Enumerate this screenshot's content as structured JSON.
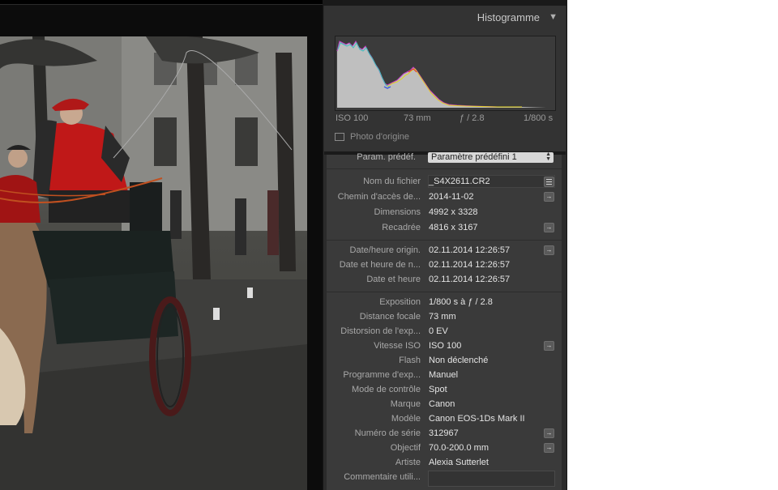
{
  "histogram": {
    "title": "Histogramme",
    "iso": "ISO 100",
    "focal": "73 mm",
    "aperture": "ƒ / 2.8",
    "shutter": "1/800 s",
    "original_photo_label": "Photo d'origine"
  },
  "preset": {
    "label": "Param. prédéf.",
    "value": "Paramètre prédéfini 1"
  },
  "file_group": [
    {
      "label": "Nom du fichier",
      "value": "_S4X2611.CR2",
      "button": "list"
    },
    {
      "label": "Chemin d'accès de...",
      "value": "2014-11-02",
      "button": "arrow"
    },
    {
      "label": "Dimensions",
      "value": "4992 x 3328",
      "button": ""
    },
    {
      "label": "Recadrée",
      "value": "4816 x 3167",
      "button": "arrow"
    }
  ],
  "date_group": [
    {
      "label": "Date/heure origin.",
      "value": "02.11.2014 12:26:57",
      "button": "arrow"
    },
    {
      "label": "Date et heure de n...",
      "value": "02.11.2014 12:26:57",
      "button": ""
    },
    {
      "label": "Date et heure",
      "value": "02.11.2014 12:26:57",
      "button": ""
    }
  ],
  "exif_group": [
    {
      "label": "Exposition",
      "value": "1/800 s à ƒ / 2.8",
      "button": ""
    },
    {
      "label": "Distance focale",
      "value": "73 mm",
      "button": ""
    },
    {
      "label": "Distorsion de l'exp...",
      "value": "0 EV",
      "button": ""
    },
    {
      "label": "Vitesse ISO",
      "value": "ISO 100",
      "button": "arrow"
    },
    {
      "label": "Flash",
      "value": "Non déclenché",
      "button": ""
    },
    {
      "label": "Programme d'exp...",
      "value": "Manuel",
      "button": ""
    },
    {
      "label": "Mode de contrôle",
      "value": "Spot",
      "button": ""
    },
    {
      "label": "Marque",
      "value": "Canon",
      "button": ""
    },
    {
      "label": "Modèle",
      "value": "Canon EOS-1Ds Mark II",
      "button": ""
    },
    {
      "label": "Numéro de série",
      "value": "312967",
      "button": "arrow"
    },
    {
      "label": "Objectif",
      "value": "70.0-200.0 mm",
      "button": "arrow"
    },
    {
      "label": "Artiste",
      "value": "Alexia Sutterlet",
      "button": ""
    },
    {
      "label": "Commentaire utili...",
      "value": "",
      "button": ""
    }
  ],
  "icons": {
    "arrow": "arrow-right-icon",
    "list": "list-icon",
    "collapse": "triangle-down-icon"
  }
}
